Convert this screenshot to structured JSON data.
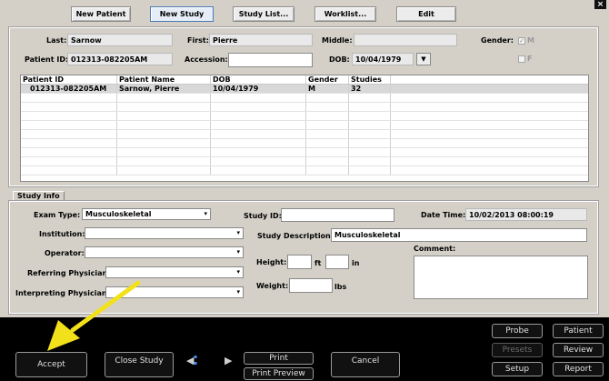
{
  "window": {
    "close_glyph": "×"
  },
  "toolbar": {
    "new_patient": "New Patient",
    "new_study": "New Study",
    "study_list": "Study List...",
    "worklist": "Worklist...",
    "edit": "Edit"
  },
  "patient": {
    "last_label": "Last:",
    "last_value": "Sarnow",
    "first_label": "First:",
    "first_value": "Pierre",
    "middle_label": "Middle:",
    "middle_value": "",
    "gender_label": "Gender:",
    "gender_m": "M",
    "gender_f": "F",
    "gender_m_checked": true,
    "gender_f_checked": false,
    "patient_id_label": "Patient ID:",
    "patient_id_value": "012313-082205AM",
    "accession_label": "Accession:",
    "accession_value": "",
    "dob_label": "DOB:",
    "dob_value": "10/04/1979"
  },
  "patient_table": {
    "columns": [
      "Patient ID",
      "Patient Name",
      "DOB",
      "Gender",
      "Studies"
    ],
    "rows": [
      [
        "012313-082205AM",
        "Sarnow, Pierre",
        "10/04/1979",
        "M",
        "32"
      ]
    ]
  },
  "study_info": {
    "tab_label": "Study Info",
    "exam_type_label": "Exam Type:",
    "exam_type_value": "Musculoskeletal",
    "institution_label": "Institution:",
    "institution_value": "",
    "operator_label": "Operator:",
    "operator_value": "",
    "referring_label": "Referring Physician:",
    "referring_value": "",
    "interpreting_label": "Interpreting Physician:",
    "interpreting_value": "",
    "study_id_label": "Study ID:",
    "study_id_value": "",
    "study_desc_label": "Study Description:",
    "study_desc_value": "Musculoskeletal",
    "height_label": "Height:",
    "height_ft_unit": "ft",
    "height_in_unit": "in",
    "height_ft_value": "",
    "height_in_value": "",
    "weight_label": "Weight:",
    "weight_unit": "lbs",
    "weight_value": "",
    "date_time_label": "Date Time:",
    "date_time_value": "10/02/2013 08:00:19",
    "comment_label": "Comment:",
    "comment_value": ""
  },
  "bottom": {
    "accept": "Accept",
    "close_study": "Close Study",
    "print": "Print",
    "print_preview": "Print Preview",
    "cancel": "Cancel",
    "probe": "Probe",
    "patient": "Patient",
    "presets": "Presets",
    "review": "Review",
    "setup": "Setup",
    "report": "Report"
  },
  "colors": {
    "background": "#d4d0c8",
    "bottom_bar": "#000000",
    "annotation_arrow": "#f2e11a"
  },
  "icons": [
    "close-icon",
    "dropdown-arrow-icon",
    "nav-left-arrow-icon",
    "nav-right-arrow-icon",
    "annotation-arrow"
  ]
}
